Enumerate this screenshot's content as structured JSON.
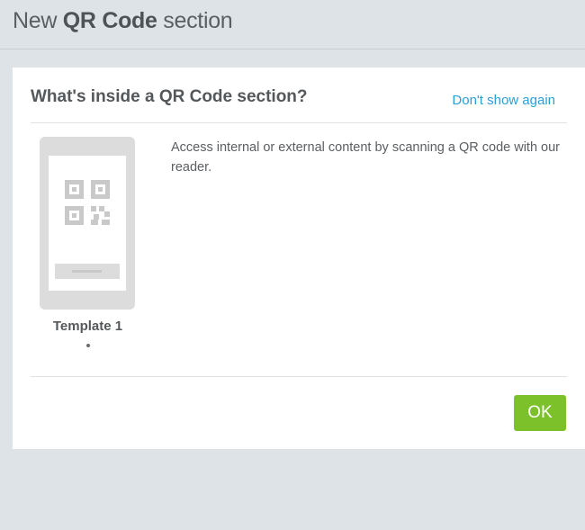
{
  "header": {
    "title_prefix": "New",
    "title_strong": "QR Code",
    "title_suffix": "section"
  },
  "dialog": {
    "title": "What's inside a QR Code section?",
    "dont_show_label": "Don't show again",
    "description": "Access internal or external content by scanning a QR code with our reader.",
    "templates": [
      {
        "label": "Template 1",
        "icon": "phone-qr-icon"
      }
    ],
    "ok_label": "OK"
  },
  "colors": {
    "accent_link": "#2a9fd8",
    "ok_button": "#7cc12a",
    "background": "#dde3e6"
  }
}
